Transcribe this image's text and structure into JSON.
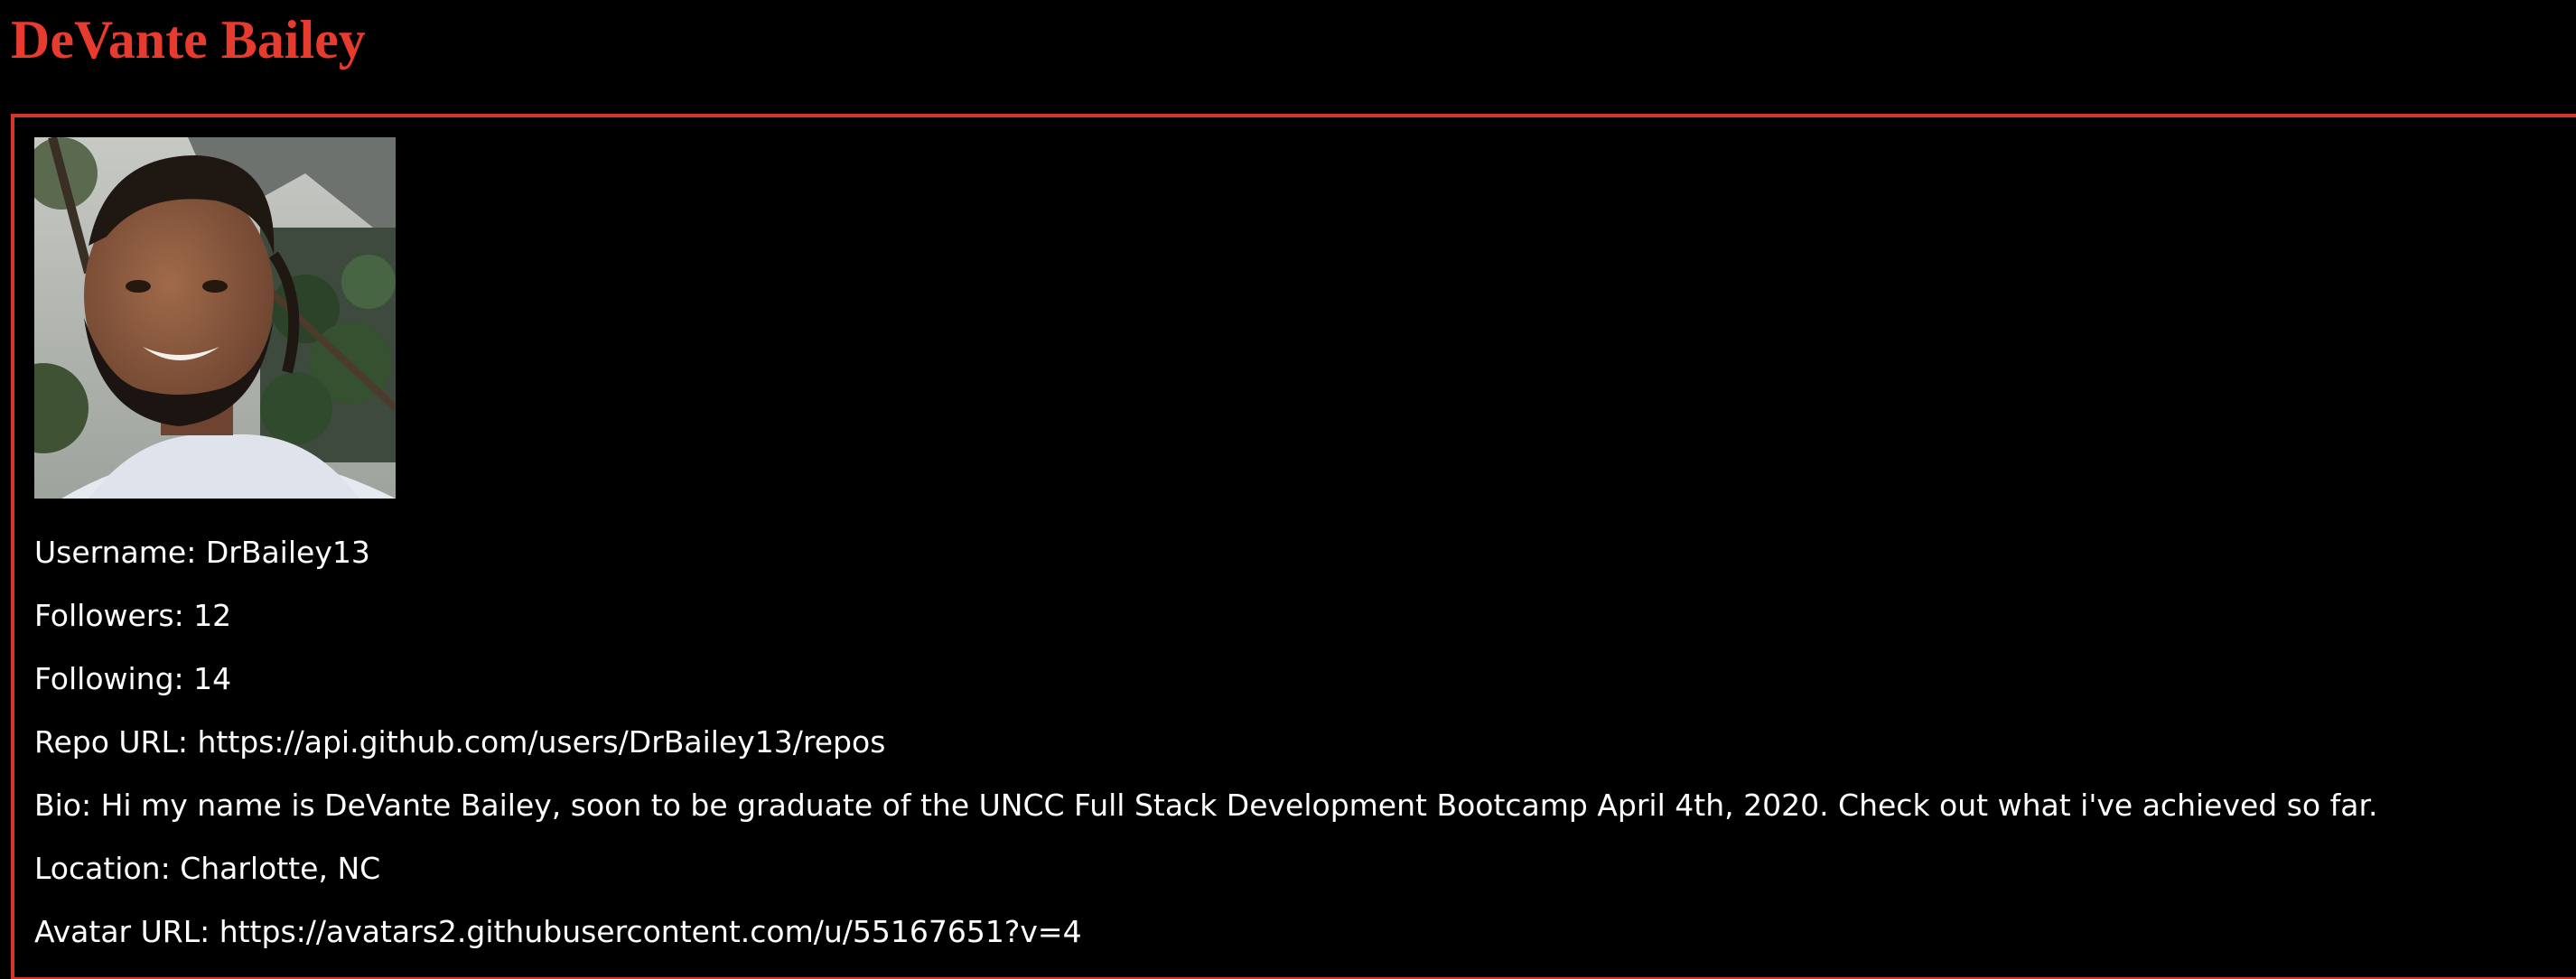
{
  "profile": {
    "name": "DeVante Bailey",
    "fields": [
      {
        "label": "Username",
        "value": "DrBailey13"
      },
      {
        "label": "Followers",
        "value": "12"
      },
      {
        "label": "Following",
        "value": "14"
      },
      {
        "label": "Repo URL",
        "value": "https://api.github.com/users/DrBailey13/repos"
      },
      {
        "label": "Bio",
        "value": "Hi my name is DeVante Bailey, soon to be graduate of the UNCC Full Stack Development Bootcamp April 4th, 2020. Check out what i've achieved so far."
      },
      {
        "label": "Location",
        "value": "Charlotte, NC"
      },
      {
        "label": "Avatar URL",
        "value": "https://avatars2.githubusercontent.com/u/55167651?v=4"
      }
    ]
  },
  "colors": {
    "background": "#000000",
    "title": "#e63b2e",
    "border": "#d8352a",
    "text": "#ffffff"
  },
  "icons": {
    "avatar": "profile-photo"
  }
}
